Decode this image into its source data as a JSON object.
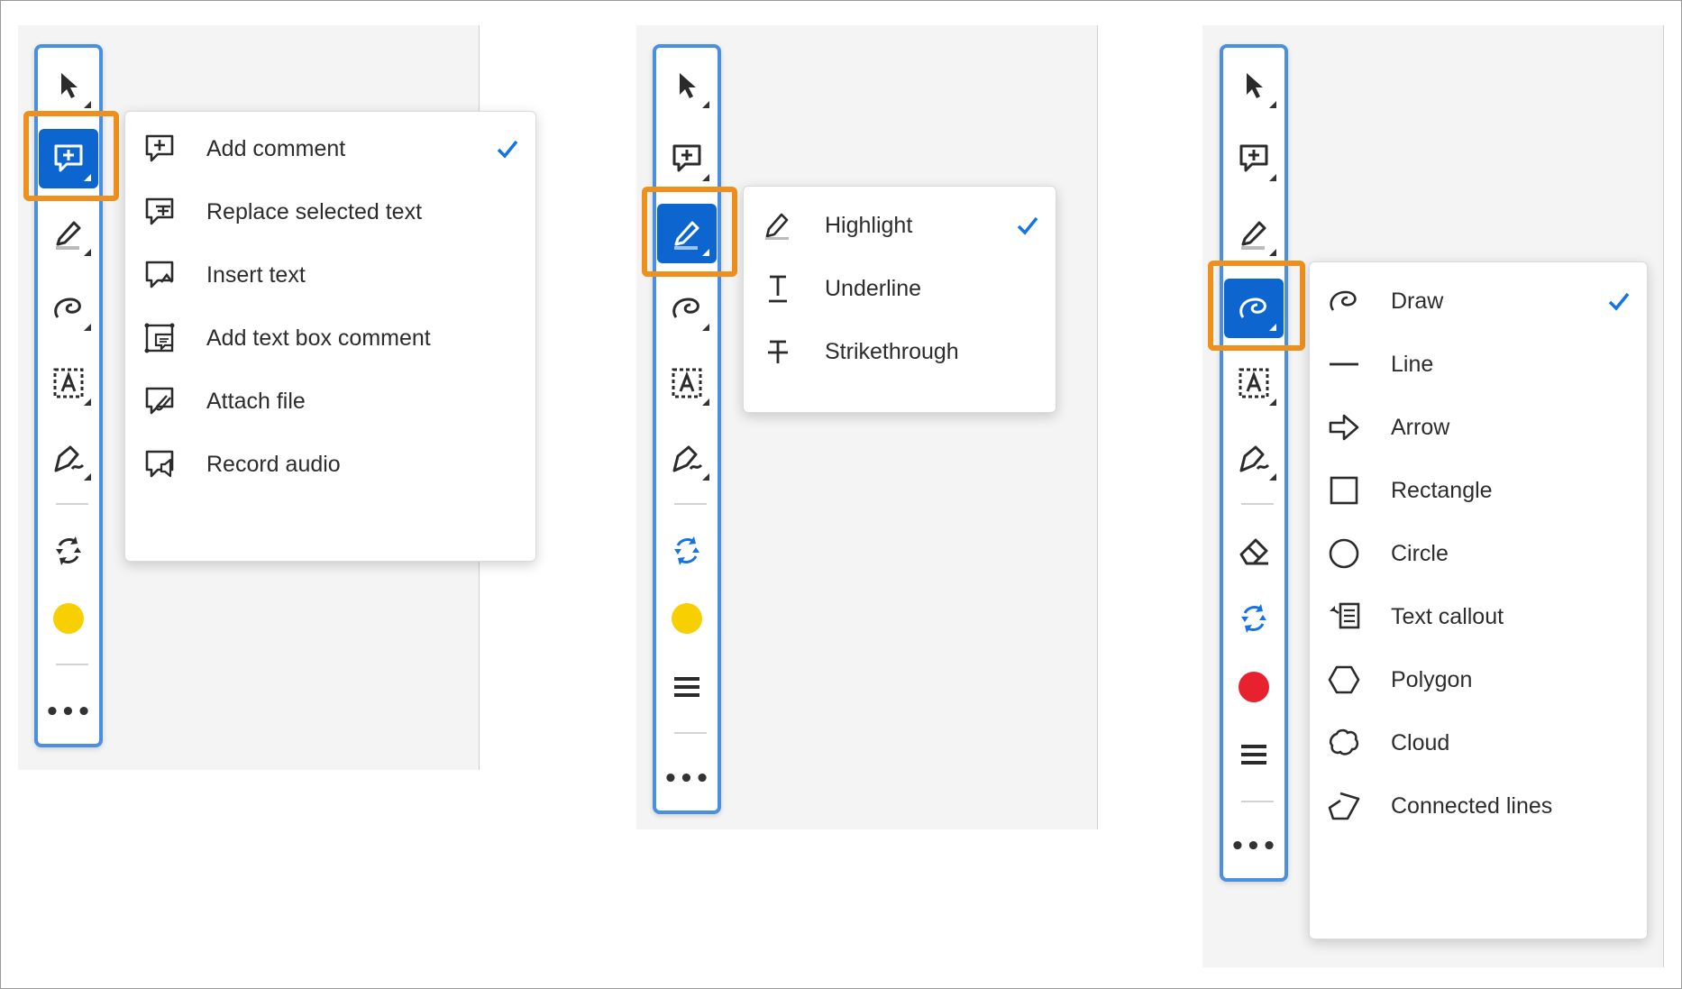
{
  "colors": {
    "selected_tool_bg": "#0d66d0",
    "toolbar_border": "#4a8fe0",
    "highlight_frame": "#f0901c",
    "checkmark": "#1473e6",
    "yellow_swatch": "#f8cf00",
    "red_swatch": "#e8212e"
  },
  "panels": [
    {
      "toolbar_icons": [
        "select-arrow-icon",
        "add-comment-icon",
        "highlight-pen-icon",
        "draw-loop-icon",
        "text-box-icon",
        "sign-pen-icon",
        "rotate-arrows-icon",
        "color-swatch-yellow",
        "more-icon"
      ],
      "selected_tool": "add-comment-icon",
      "menu": [
        {
          "label": "Add comment",
          "icon": "comment-plus-icon",
          "checked": true
        },
        {
          "label": "Replace selected text",
          "icon": "replace-text-icon",
          "checked": false
        },
        {
          "label": "Insert text",
          "icon": "insert-text-icon",
          "checked": false
        },
        {
          "label": "Add text box comment",
          "icon": "text-box-comment-icon",
          "checked": false
        },
        {
          "label": "Attach file",
          "icon": "attach-file-icon",
          "checked": false
        },
        {
          "label": "Record audio",
          "icon": "record-audio-icon",
          "checked": false
        }
      ]
    },
    {
      "toolbar_icons": [
        "select-arrow-icon",
        "add-comment-icon",
        "highlight-pen-icon",
        "draw-loop-icon",
        "text-box-icon",
        "sign-pen-icon",
        "rotate-arrows-icon",
        "color-swatch-yellow",
        "line-weight-icon",
        "more-icon"
      ],
      "selected_tool": "highlight-pen-icon",
      "menu": [
        {
          "label": "Highlight",
          "icon": "highlight-icon",
          "checked": true
        },
        {
          "label": "Underline",
          "icon": "underline-icon",
          "checked": false
        },
        {
          "label": "Strikethrough",
          "icon": "strikethrough-icon",
          "checked": false
        }
      ]
    },
    {
      "toolbar_icons": [
        "select-arrow-icon",
        "add-comment-icon",
        "highlight-pen-icon",
        "draw-loop-icon",
        "text-box-icon",
        "sign-pen-icon",
        "eraser-icon",
        "rotate-arrows-icon",
        "color-swatch-red",
        "line-weight-icon",
        "more-icon"
      ],
      "selected_tool": "draw-loop-icon",
      "menu": [
        {
          "label": "Draw",
          "icon": "draw-loop-icon",
          "checked": true
        },
        {
          "label": "Line",
          "icon": "line-icon",
          "checked": false
        },
        {
          "label": "Arrow",
          "icon": "arrow-icon",
          "checked": false
        },
        {
          "label": "Rectangle",
          "icon": "rectangle-icon",
          "checked": false
        },
        {
          "label": "Circle",
          "icon": "circle-icon",
          "checked": false
        },
        {
          "label": "Text callout",
          "icon": "text-callout-icon",
          "checked": false
        },
        {
          "label": "Polygon",
          "icon": "polygon-icon",
          "checked": false
        },
        {
          "label": "Cloud",
          "icon": "cloud-icon",
          "checked": false
        },
        {
          "label": "Connected lines",
          "icon": "connected-lines-icon",
          "checked": false
        }
      ]
    }
  ]
}
